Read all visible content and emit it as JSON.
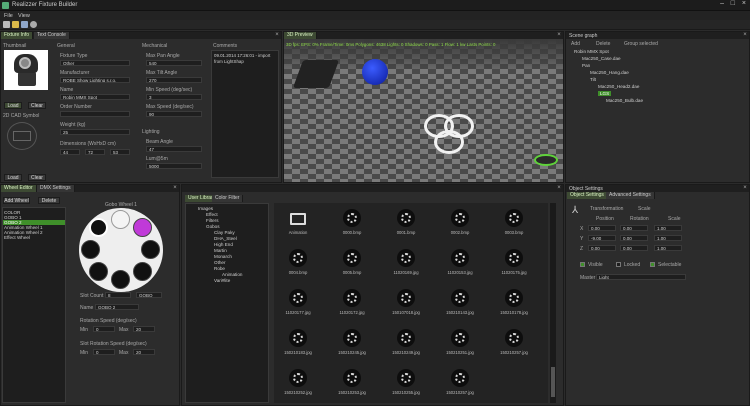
{
  "app": {
    "title": "Realizzer Fixture Builder",
    "menu": [
      "File",
      "View"
    ]
  },
  "left_panel": {
    "tabs": [
      "Fixture Info",
      "Text Console"
    ],
    "thumbnail_label": "Thumbnail",
    "thumb_buttons": [
      "Load",
      "Clear"
    ],
    "cad_label": "2D CAD Symbol",
    "cad_buttons": [
      "Load",
      "Clear"
    ],
    "general": {
      "title": "General",
      "fixture_type_label": "Fixture Type",
      "fixture_type": "Other",
      "manufacturer_label": "Manufacturer",
      "manufacturer": "ROBE Show Lighting s.r.o.",
      "name_label": "Name",
      "name": "Robin MMX Spot",
      "order_label": "Order Number",
      "order": "",
      "weight_label": "Weight (kg)",
      "weight": "25",
      "dimensions_label": "Dimensions (WxHxD cm)",
      "dim": [
        "44",
        "72",
        "53"
      ]
    },
    "mechanical": {
      "title": "Mechanical",
      "max_pan_label": "Max Pan Angle",
      "max_pan": "540",
      "max_tilt_label": "Max Tilt Angle",
      "max_tilt": "270",
      "min_speed_label": "Min Speed (deg/sec)",
      "min_speed": "3",
      "max_speed_label": "Max Speed (deg/sec)",
      "max_speed": "90"
    },
    "lighting": {
      "title": "Lighting",
      "beam_label": "Beam Angle",
      "beam": "47",
      "lumen_label": "Lum@5m",
      "lumen": "5000"
    },
    "comments": {
      "title": "Comments",
      "text": "09.01.2014 17:26:01 - import from LightShap"
    }
  },
  "preview": {
    "title": "3D Preview",
    "stats": "3D fps: EPS: 0% Frame/Time: 0ms   Polygons: 4638 Lights: 0 Shadows: 0 Pass: 1 Flow: 1 kw  Lasts Points: 0"
  },
  "scene_graph": {
    "title": "Scene graph",
    "actions": [
      "Add",
      "Delete",
      "Group selected"
    ],
    "items": [
      "Robin MMX Spot",
      "Mac250_Case.dae",
      "Pan",
      "Mac250_Hang.dae",
      "Tilt",
      "Mac250_Head2.dae",
      "LGS",
      "Mac250_Bulb.dae"
    ]
  },
  "wheel_editor": {
    "tabs": [
      "Wheel Editor",
      "DMX Settings"
    ],
    "buttons": [
      "Add Wheel",
      "Delete"
    ],
    "list": [
      "COLOR",
      "GOBO 1",
      "GOBO 2",
      "Animation Wheel 1",
      "Animation Wheel 2",
      "Effect Wheel"
    ],
    "selected": "GOBO 2",
    "wheel_title": "Gobo Wheel 1",
    "slot_count_label": "Slot Count",
    "slot_count": "8",
    "slot_type": "GOBO",
    "name_label": "Name",
    "name": "GOBO 2",
    "rot_label": "Rotation Speed (deg/sec)",
    "rot_min_label": "Min",
    "rot_min": "0",
    "rot_max_label": "Max",
    "rot_max": "20",
    "slot_rot_label": "Slot Rotation Speed (deg/sec)",
    "slot_min_label": "Min",
    "slot_min": "0",
    "slot_max_label": "Max",
    "slot_max": "20"
  },
  "library": {
    "tabs": [
      "User Library",
      "Color Filter"
    ],
    "tree": [
      "Images",
      "Effect",
      "Filters",
      "Gobos",
      "Clay Paky",
      "DHA_Steel",
      "High End",
      "Martin",
      "Monarch",
      "Other",
      "Robe",
      "Animation",
      "Vari#lite"
    ],
    "thumbs": [
      "Animation",
      "0000.bmp",
      "0001.bmp",
      "0002.bmp",
      "0003.bmp",
      "0004.bmp",
      "0005.bmp",
      "11020169.jpg",
      "11020153.jpg",
      "11020175.jpg",
      "11020177.jpg",
      "11020172.jpg",
      "150107018.jpg",
      "150210143.jpg",
      "150210178.jpg",
      "150210183.jpg",
      "150210245.jpg",
      "150210249.jpg",
      "150210251.jpg",
      "150210257.jpg",
      "150210252.jpg",
      "150210253.jpg",
      "150210255.jpg",
      "150210257.jpg"
    ]
  },
  "object_settings": {
    "title": "Object Settings",
    "tabs": [
      "Object Settings",
      "Advanced Settings"
    ],
    "transformation": "Transformation",
    "scale_label": "Scale",
    "headers": [
      "Position",
      "Rotation",
      "Scale"
    ],
    "rows": [
      {
        "axis": "X",
        "pos": "0.00",
        "rot": "0.00",
        "scale": "1.00"
      },
      {
        "axis": "Y",
        "pos": "-9.00",
        "rot": "0.00",
        "scale": "1.00"
      },
      {
        "axis": "Z",
        "pos": "0.00",
        "rot": "0.00",
        "scale": "1.00"
      }
    ],
    "checks": [
      "Visible",
      "Locked",
      "Selectable"
    ],
    "master_label": "Master",
    "master": "Light"
  }
}
